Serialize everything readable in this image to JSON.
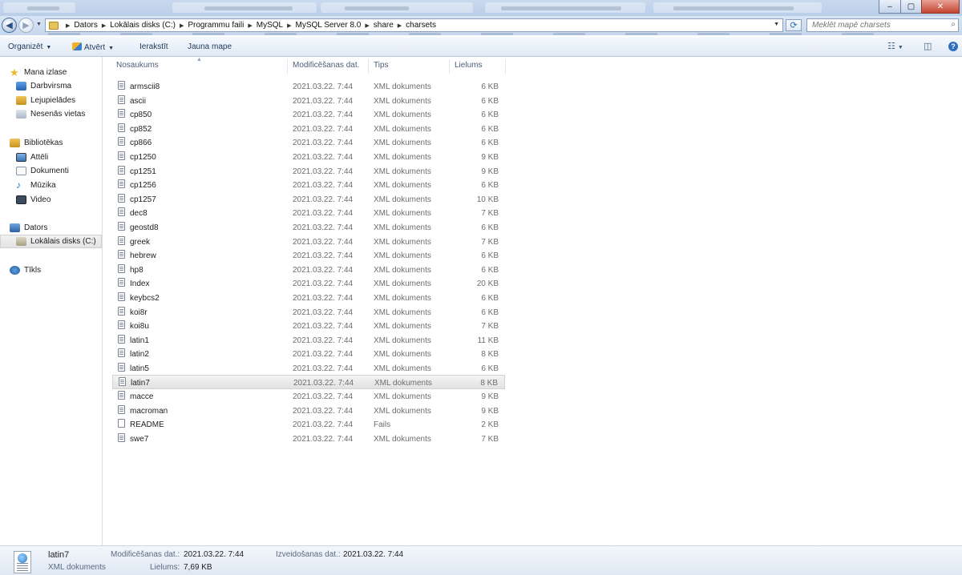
{
  "window": {
    "minimize_glyph": "–",
    "maximize_glyph": "▢",
    "close_glyph": "✕"
  },
  "address": {
    "back_glyph": "◀",
    "forward_glyph": "▶",
    "crumbs": [
      "Dators",
      "Lokālais disks (C:)",
      "Programmu faili",
      "MySQL",
      "MySQL Server 8.0",
      "share",
      "charsets"
    ],
    "refresh_glyph": "⟳",
    "search_placeholder": "Meklēt mapē charsets"
  },
  "toolbar": {
    "organize": "Organizēt",
    "open": "Atvērt",
    "burn": "Ierakstīt",
    "new_folder": "Jauna mape",
    "help_glyph": "?"
  },
  "nav": {
    "favorites": "Mana izlase",
    "desktop": "Darbvirsma",
    "downloads": "Lejupielādes",
    "recent": "Nesenās vietas",
    "libraries": "Bibliotēkas",
    "pictures": "Attēli",
    "documents": "Dokumenti",
    "music": "Mūzika",
    "video": "Video",
    "computer": "Dators",
    "local_disk": "Lokālais disks (C:)",
    "network": "Tīkls"
  },
  "columns": {
    "name": "Nosaukums",
    "modified": "Modificēšanas dat.",
    "type": "Tips",
    "size": "Lielums"
  },
  "files": [
    {
      "name": "armscii8",
      "date": "2021.03.22. 7:44",
      "type": "XML dokuments",
      "size": "6 KB"
    },
    {
      "name": "ascii",
      "date": "2021.03.22. 7:44",
      "type": "XML dokuments",
      "size": "6 KB"
    },
    {
      "name": "cp850",
      "date": "2021.03.22. 7:44",
      "type": "XML dokuments",
      "size": "6 KB"
    },
    {
      "name": "cp852",
      "date": "2021.03.22. 7:44",
      "type": "XML dokuments",
      "size": "6 KB"
    },
    {
      "name": "cp866",
      "date": "2021.03.22. 7:44",
      "type": "XML dokuments",
      "size": "6 KB"
    },
    {
      "name": "cp1250",
      "date": "2021.03.22. 7:44",
      "type": "XML dokuments",
      "size": "9 KB"
    },
    {
      "name": "cp1251",
      "date": "2021.03.22. 7:44",
      "type": "XML dokuments",
      "size": "9 KB"
    },
    {
      "name": "cp1256",
      "date": "2021.03.22. 7:44",
      "type": "XML dokuments",
      "size": "6 KB"
    },
    {
      "name": "cp1257",
      "date": "2021.03.22. 7:44",
      "type": "XML dokuments",
      "size": "10 KB"
    },
    {
      "name": "dec8",
      "date": "2021.03.22. 7:44",
      "type": "XML dokuments",
      "size": "7 KB"
    },
    {
      "name": "geostd8",
      "date": "2021.03.22. 7:44",
      "type": "XML dokuments",
      "size": "6 KB"
    },
    {
      "name": "greek",
      "date": "2021.03.22. 7:44",
      "type": "XML dokuments",
      "size": "7 KB"
    },
    {
      "name": "hebrew",
      "date": "2021.03.22. 7:44",
      "type": "XML dokuments",
      "size": "6 KB"
    },
    {
      "name": "hp8",
      "date": "2021.03.22. 7:44",
      "type": "XML dokuments",
      "size": "6 KB"
    },
    {
      "name": "Index",
      "date": "2021.03.22. 7:44",
      "type": "XML dokuments",
      "size": "20 KB"
    },
    {
      "name": "keybcs2",
      "date": "2021.03.22. 7:44",
      "type": "XML dokuments",
      "size": "6 KB"
    },
    {
      "name": "koi8r",
      "date": "2021.03.22. 7:44",
      "type": "XML dokuments",
      "size": "6 KB"
    },
    {
      "name": "koi8u",
      "date": "2021.03.22. 7:44",
      "type": "XML dokuments",
      "size": "7 KB"
    },
    {
      "name": "latin1",
      "date": "2021.03.22. 7:44",
      "type": "XML dokuments",
      "size": "11 KB"
    },
    {
      "name": "latin2",
      "date": "2021.03.22. 7:44",
      "type": "XML dokuments",
      "size": "8 KB"
    },
    {
      "name": "latin5",
      "date": "2021.03.22. 7:44",
      "type": "XML dokuments",
      "size": "6 KB"
    },
    {
      "name": "latin7",
      "date": "2021.03.22. 7:44",
      "type": "XML dokuments",
      "size": "8 KB"
    },
    {
      "name": "macce",
      "date": "2021.03.22. 7:44",
      "type": "XML dokuments",
      "size": "9 KB"
    },
    {
      "name": "macroman",
      "date": "2021.03.22. 7:44",
      "type": "XML dokuments",
      "size": "9 KB"
    },
    {
      "name": "README",
      "date": "2021.03.22. 7:44",
      "type": "Fails",
      "size": "2 KB"
    },
    {
      "name": "swe7",
      "date": "2021.03.22. 7:44",
      "type": "XML dokuments",
      "size": "7 KB"
    }
  ],
  "selected_file": "latin7",
  "details": {
    "name": "latin7",
    "type": "XML dokuments",
    "modified_label": "Modificēšanas dat.:",
    "modified_value": "2021.03.22. 7:44",
    "created_label": "Izveidošanas dat.:",
    "created_value": "2021.03.22. 7:44",
    "size_label": "Lielums:",
    "size_value": "7,69 KB"
  },
  "colors": {
    "titlebar": "#c9d9ee",
    "toolbar_text": "#1e395b",
    "selection": "#e2e2e2",
    "secondary_text": "#6d6d6d"
  }
}
